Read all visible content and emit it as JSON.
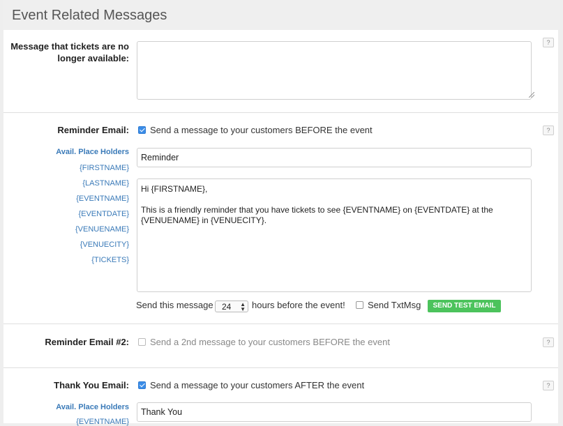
{
  "panel": {
    "title": "Event Related Messages"
  },
  "help_label": "?",
  "no_tickets": {
    "label": "Message that tickets are no longer available:",
    "value": ""
  },
  "reminder": {
    "label": "Reminder Email:",
    "checkbox_label": "Send a message to your customers BEFORE the event",
    "checked": true,
    "placeholders_title": "Avail. Place Holders",
    "placeholders": [
      "{FIRSTNAME}",
      "{LASTNAME}",
      "{EVENTNAME}",
      "{EVENTDATE}",
      "{VENUENAME}",
      "{VENUECITY}",
      "{TICKETS}"
    ],
    "subject": "Reminder",
    "body_line1": "Hi {FIRSTNAME},",
    "body_line2": "This is a friendly reminder that you have tickets to see {EVENTNAME} on {EVENTDATE} at the {VENUENAME} in {VENUECITY}.",
    "send_prefix": "Send this message",
    "hours_value": "24",
    "send_suffix": "hours before the event!",
    "txtmsg_label": "Send TxtMsg",
    "txtmsg_checked": false,
    "test_button": "SEND TEST EMAIL"
  },
  "reminder2": {
    "label": "Reminder Email #2:",
    "checkbox_label": "Send a 2nd message to your customers BEFORE the event",
    "checked": false
  },
  "thankyou": {
    "label": "Thank You Email:",
    "checkbox_label": "Send a message to your customers AFTER the event",
    "checked": true,
    "placeholders_title": "Avail. Place Holders",
    "first_placeholder": "{EVENTNAME}",
    "subject": "Thank You"
  },
  "colors": {
    "accent_blue": "#3b8de8",
    "link_blue": "#3a7ab8",
    "button_green": "#4cc35c"
  }
}
